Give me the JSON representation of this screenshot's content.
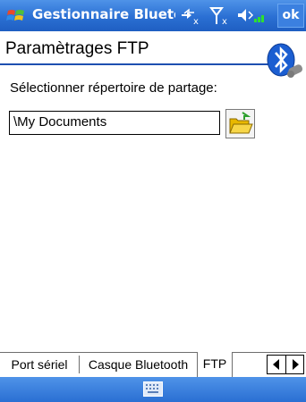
{
  "titlebar": {
    "app_title": "Gestionnaire Bluetoo",
    "ok_label": "ok"
  },
  "header": {
    "title": "Paramètrages FTP"
  },
  "content": {
    "prompt": "Sélectionner répertoire de partage:",
    "path_value": "\\My Documents"
  },
  "tabs": [
    {
      "label": "Port sériel",
      "active": false
    },
    {
      "label": "Casque Bluetooth",
      "active": false
    },
    {
      "label": "FTP",
      "active": true
    }
  ],
  "colors": {
    "titlebar": "#2a6fd3",
    "header_line": "#1e4fb0"
  },
  "icons": {
    "start": "windows-flag-icon",
    "connectivity": "connectivity-icon",
    "signal": "signal-strength-icon",
    "volume": "speaker-icon",
    "bluetooth": "bluetooth-icon",
    "folder": "open-folder-icon",
    "keyboard": "keyboard-icon"
  }
}
